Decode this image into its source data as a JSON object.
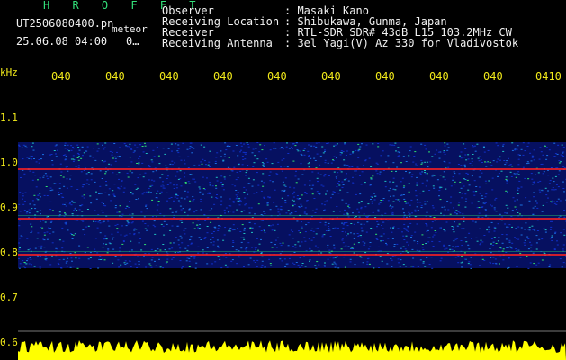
{
  "header": {
    "title_lettering": "H R O F F T",
    "file_name": "UT2506080400.pn",
    "tag": "meteor",
    "datetime": "25.06.08 04:00",
    "short_code": "0…",
    "fields": [
      {
        "label": "Observer",
        "value": ": Masaki Kano"
      },
      {
        "label": "Receiving Location",
        "value": ": Shibukawa, Gunma, Japan"
      },
      {
        "label": "Receiver",
        "value": ": RTL-SDR SDR# 43dB L15 103.2MHz CW"
      },
      {
        "label": "Receiving Antenna",
        "value": ": 3el Yagi(V) Az 330 for Vladivostok"
      }
    ]
  },
  "axis": {
    "unit": "kHz",
    "y_ticks": [
      "1.1",
      "1.0",
      "0.9",
      "0.8",
      "0.7",
      "0.6"
    ],
    "x_ticks": [
      "040",
      "040",
      "040",
      "040",
      "040",
      "040",
      "040",
      "040",
      "040",
      "0410"
    ]
  },
  "colors": {
    "background": "#000000",
    "label_green": "#33e07a",
    "label_white": "#f2f2f2",
    "label_yellow": "#f2ea1a",
    "noise_yellow": "#ffff00",
    "band_blue": "#1030c8",
    "line_red": "#ff2020",
    "echo_green": "#30e070"
  },
  "waterfall": {
    "band_top_khz": 1.04,
    "band_bottom_khz": 0.76,
    "carrier_lines_khz": [
      0.98,
      0.87,
      0.79
    ],
    "baseline_khz": 0.6
  }
}
